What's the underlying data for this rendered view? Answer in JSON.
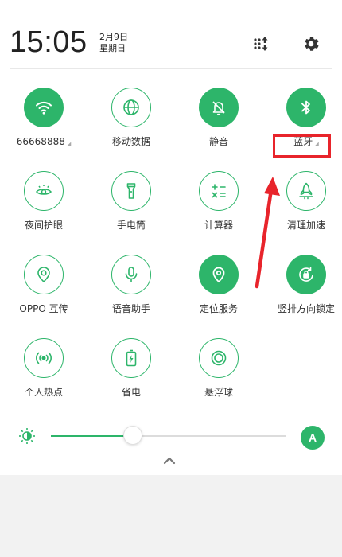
{
  "header": {
    "time": "15:05",
    "date": "2月9日",
    "weekday": "星期日",
    "edit_icon": "edit-tiles-icon",
    "settings_icon": "gear-icon"
  },
  "tiles": [
    {
      "label": "66668888",
      "icon": "wifi-icon",
      "active": true,
      "expandable": true
    },
    {
      "label": "移动数据",
      "icon": "globe-icon",
      "active": false
    },
    {
      "label": "静音",
      "icon": "bell-mute-icon",
      "active": true
    },
    {
      "label": "蓝牙",
      "icon": "bluetooth-icon",
      "active": true,
      "expandable": true
    },
    {
      "label": "夜间护眼",
      "icon": "eye-icon",
      "active": false
    },
    {
      "label": "手电筒",
      "icon": "flashlight-icon",
      "active": false
    },
    {
      "label": "计算器",
      "icon": "calculator-icon",
      "active": false
    },
    {
      "label": "清理加速",
      "icon": "rocket-icon",
      "active": false
    },
    {
      "label": "OPPO 互传",
      "icon": "share-icon",
      "active": false
    },
    {
      "label": "语音助手",
      "icon": "microphone-icon",
      "active": false
    },
    {
      "label": "定位服务",
      "icon": "location-icon",
      "active": true
    },
    {
      "label": "竖排方向锁定",
      "icon": "rotation-lock-icon",
      "active": true
    },
    {
      "label": "个人热点",
      "icon": "hotspot-icon",
      "active": false
    },
    {
      "label": "省电",
      "icon": "battery-icon",
      "active": false
    },
    {
      "label": "悬浮球",
      "icon": "floating-ball-icon",
      "active": false
    }
  ],
  "brightness": {
    "level": 0.35,
    "auto_label": "A"
  },
  "colors": {
    "accent": "#2db56a",
    "highlight": "#e8242b"
  }
}
